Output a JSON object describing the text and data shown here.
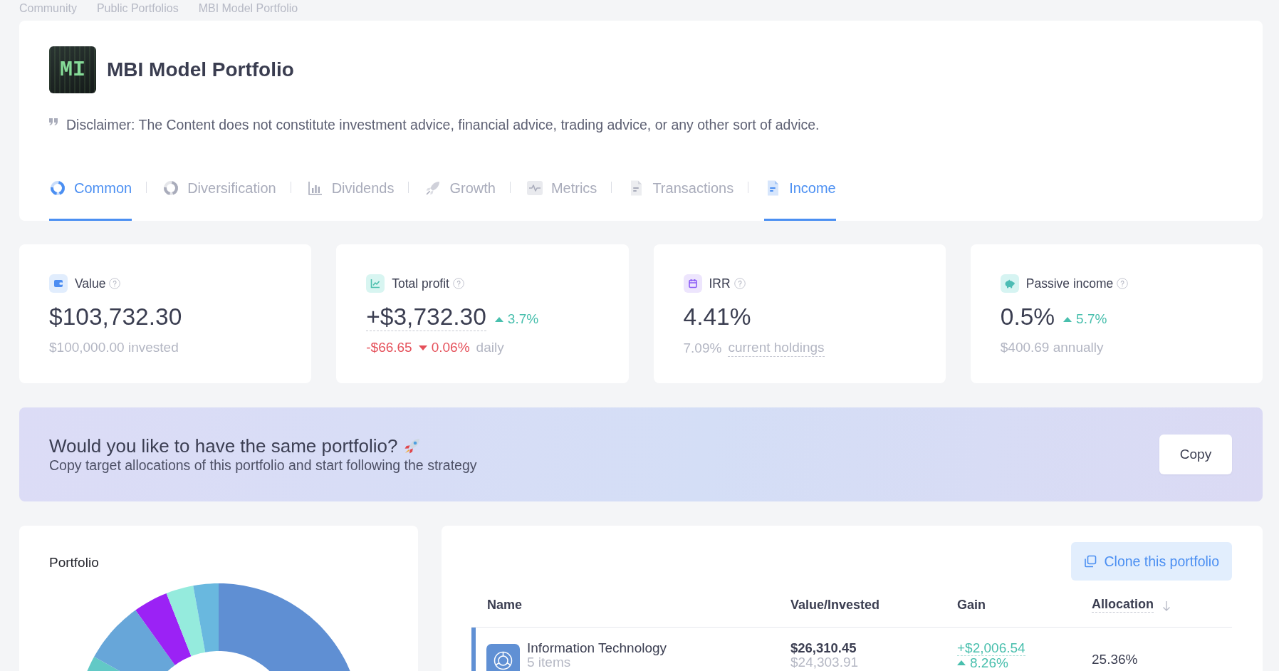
{
  "breadcrumb": [
    "Community",
    "Public Portfolios",
    "MBI Model Portfolio"
  ],
  "header": {
    "logo_text": "MI",
    "title": "MBI Model Portfolio",
    "disclaimer": "Disclaimer: The Content does not constitute investment advice, financial advice, trading advice, or any other sort of advice."
  },
  "tabs": [
    {
      "label": "Common",
      "selected": true
    },
    {
      "label": "Diversification",
      "selected": false
    },
    {
      "label": "Dividends",
      "selected": false
    },
    {
      "label": "Growth",
      "selected": false
    },
    {
      "label": "Metrics",
      "selected": false
    },
    {
      "label": "Transactions",
      "selected": false
    },
    {
      "label": "Income",
      "selected": true
    }
  ],
  "stats": [
    {
      "label": "Value",
      "value": "$103,732.30",
      "value_underlined": false,
      "details": [
        {
          "kind": "text",
          "text": "$100,000.00 invested",
          "negative": false,
          "underlined": false
        }
      ]
    },
    {
      "label": "Total profit",
      "value": "+$3,732.30",
      "value_underlined": true,
      "change": {
        "text": "3.7%",
        "up": true
      },
      "details": [
        {
          "kind": "text",
          "text": "-$66.65",
          "negative": true,
          "underlined": false
        },
        {
          "kind": "change",
          "text": "0.06%",
          "up": false
        },
        {
          "kind": "text",
          "text": "daily",
          "negative": false,
          "underlined": false
        }
      ]
    },
    {
      "label": "IRR",
      "value": "4.41%",
      "value_underlined": false,
      "details": [
        {
          "kind": "text",
          "text": "7.09%",
          "negative": false,
          "underlined": false
        },
        {
          "kind": "text",
          "text": "current holdings",
          "negative": false,
          "underlined": true
        }
      ]
    },
    {
      "label": "Passive income",
      "value": "0.5%",
      "value_underlined": false,
      "change": {
        "text": "5.7%",
        "up": true
      },
      "details": [
        {
          "kind": "text",
          "text": "$400.69 annually",
          "negative": false,
          "underlined": false
        }
      ]
    }
  ],
  "banner": {
    "title": "Would you like to have the same portfolio?",
    "subtitle": "Copy target allocations of this portfolio and start following the strategy",
    "button": "Copy"
  },
  "portfolio_chart": {
    "title": "Portfolio"
  },
  "holdings": {
    "button": "Clone this portfolio",
    "columns": [
      {
        "label": "Name",
        "sorted": false,
        "underlined": false
      },
      {
        "label": "Value/Invested",
        "sorted": false,
        "underlined": false
      },
      {
        "label": "Gain",
        "sorted": false,
        "underlined": false
      },
      {
        "label": "Allocation",
        "sorted": true,
        "underlined": true
      }
    ],
    "rows": [
      {
        "name": "Information Technology",
        "count": "5 items",
        "color": "#6090d4",
        "value": "$26,310.45",
        "invested": "$24,303.91",
        "gain": "+$2,006.54",
        "gain_up": true,
        "gain_percent": "8.26%",
        "allocation": "25.36%"
      }
    ]
  }
}
